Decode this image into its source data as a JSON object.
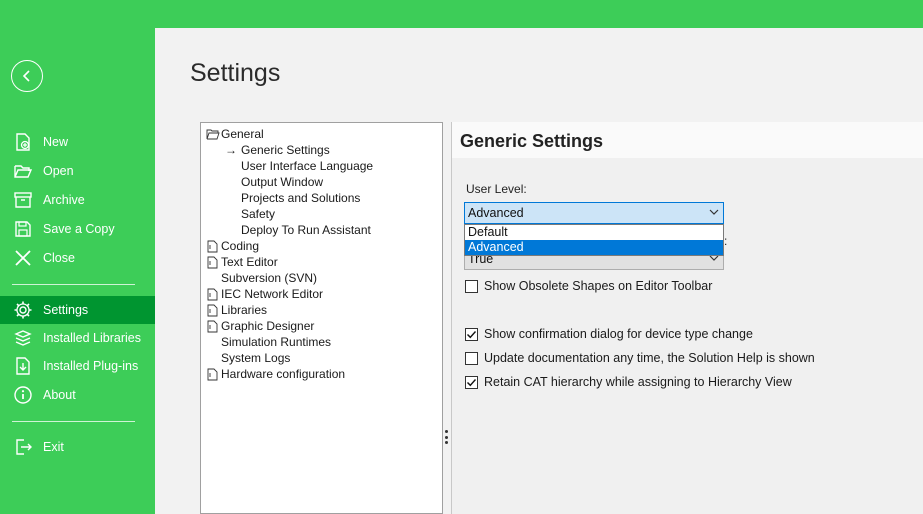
{
  "colors": {
    "brand_green": "#3dcd58",
    "active_green": "#009530",
    "selection_blue": "#0078d7"
  },
  "sidebar": {
    "back_icon": "back-arrow-circle-icon",
    "items": [
      {
        "label": "New",
        "icon": "new-file-icon"
      },
      {
        "label": "Open",
        "icon": "open-folder-icon"
      },
      {
        "label": "Archive",
        "icon": "archive-icon"
      },
      {
        "label": "Save a Copy",
        "icon": "save-copy-icon"
      },
      {
        "label": "Close",
        "icon": "close-icon"
      },
      {
        "label": "Settings",
        "icon": "gear-icon",
        "active": true
      },
      {
        "label": "Installed Libraries",
        "icon": "libraries-icon"
      },
      {
        "label": "Installed Plug-ins",
        "icon": "plugins-icon"
      },
      {
        "label": "About",
        "icon": "info-icon"
      },
      {
        "label": "Exit",
        "icon": "exit-icon"
      }
    ]
  },
  "page": {
    "title": "Settings"
  },
  "tree": {
    "nodes": [
      {
        "label": "General",
        "level": 0,
        "icon": "folder-open-icon"
      },
      {
        "label": "Generic Settings",
        "level": 1,
        "selected": true
      },
      {
        "label": "User Interface Language",
        "level": 1
      },
      {
        "label": "Output Window",
        "level": 1
      },
      {
        "label": "Projects and Solutions",
        "level": 1
      },
      {
        "label": "Safety",
        "level": 1
      },
      {
        "label": "Deploy To Run Assistant",
        "level": 1
      },
      {
        "label": "Coding",
        "level": 0,
        "icon": "folder-icon"
      },
      {
        "label": "Text Editor",
        "level": 0,
        "icon": "folder-icon"
      },
      {
        "label": "Subversion (SVN)",
        "level": 0
      },
      {
        "label": "IEC Network Editor",
        "level": 0,
        "icon": "folder-icon"
      },
      {
        "label": "Libraries",
        "level": 0,
        "icon": "folder-icon"
      },
      {
        "label": "Graphic Designer",
        "level": 0,
        "icon": "folder-icon"
      },
      {
        "label": "Simulation Runtimes",
        "level": 0
      },
      {
        "label": "System Logs",
        "level": 0
      },
      {
        "label": "Hardware configuration",
        "level": 0,
        "icon": "folder-icon"
      }
    ]
  },
  "panel": {
    "title": "Generic Settings",
    "user_level_label": "User Level:",
    "user_level_value": "Advanced",
    "user_level_options": [
      "Default",
      "Advanced"
    ],
    "hidden_combo_value": "True",
    "hidden_label_tail": ":",
    "checkboxes": [
      {
        "label": "Show Obsolete Shapes on Editor Toolbar",
        "checked": false
      },
      {
        "label": "Show confirmation dialog for device type change",
        "checked": true
      },
      {
        "label": "Update documentation any time, the Solution Help is shown",
        "checked": false
      },
      {
        "label": "Retain CAT hierarchy while assigning to Hierarchy View",
        "checked": true
      }
    ]
  }
}
